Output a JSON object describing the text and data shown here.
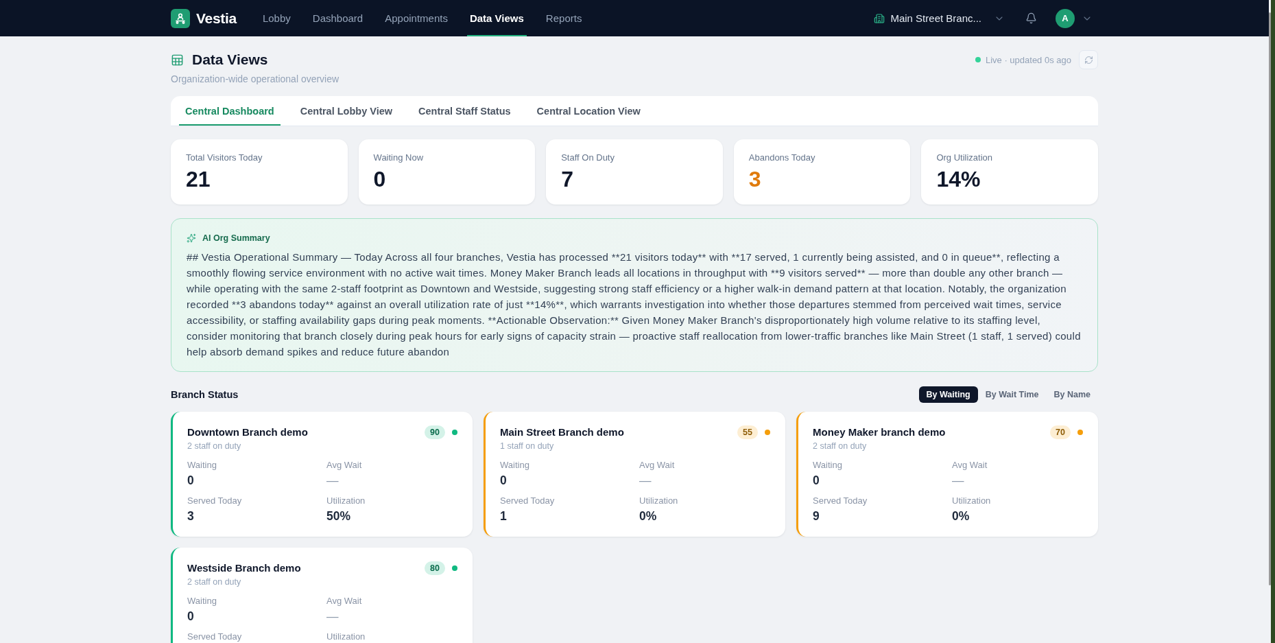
{
  "nav": {
    "brand": "Vestia",
    "items": [
      {
        "label": "Lobby",
        "selected": false
      },
      {
        "label": "Dashboard",
        "selected": false
      },
      {
        "label": "Appointments",
        "selected": false
      },
      {
        "label": "Data Views",
        "selected": true
      },
      {
        "label": "Reports",
        "selected": false
      }
    ],
    "branch_selector": "Main Street Branc...",
    "avatar": "A"
  },
  "header": {
    "title": "Data Views",
    "subtitle": "Organization-wide operational overview",
    "live_status": "Live · updated 0s ago"
  },
  "tabs": [
    {
      "label": "Central Dashboard",
      "selected": true
    },
    {
      "label": "Central Lobby View",
      "selected": false
    },
    {
      "label": "Central Staff Status",
      "selected": false
    },
    {
      "label": "Central Location View",
      "selected": false
    }
  ],
  "kpis": [
    {
      "label": "Total Visitors Today",
      "value": "21",
      "color": "#0f172a"
    },
    {
      "label": "Waiting Now",
      "value": "0",
      "color": "#0f172a"
    },
    {
      "label": "Staff On Duty",
      "value": "7",
      "color": "#0f172a"
    },
    {
      "label": "Abandons Today",
      "value": "3",
      "color": "#e07b0c"
    },
    {
      "label": "Org Utilization",
      "value": "14%",
      "color": "#0f172a"
    }
  ],
  "ai_summary": {
    "title": "AI Org Summary",
    "text": "## Vestia Operational Summary — Today Across all four branches, Vestia has processed **21 visitors today** with **17 served, 1 currently being assisted, and 0 in queue**, reflecting a smoothly flowing service environment with no active wait times. Money Maker Branch leads all locations in throughput with **9 visitors served** — more than double any other branch — while operating with the same 2-staff footprint as Downtown and Westside, suggesting strong staff efficiency or a higher walk-in demand pattern at that location. Notably, the organization recorded **3 abandons today** against an overall utilization rate of just **14%**, which warrants investigation into whether those departures stemmed from perceived wait times, service accessibility, or staffing availability gaps during peak moments. **Actionable Observation:** Given Money Maker Branch's disproportionately high volume relative to its staffing level, consider monitoring that branch closely during peak hours for early signs of capacity strain — proactive staff reallocation from lower-traffic branches like Main Street (1 staff, 1 served) could help absorb demand spikes and reduce future abandon"
  },
  "branch_status": {
    "title": "Branch Status",
    "sort_options": [
      {
        "label": "By Waiting",
        "selected": true
      },
      {
        "label": "By Wait Time",
        "selected": false
      },
      {
        "label": "By Name",
        "selected": false
      }
    ],
    "branches": [
      {
        "name": "Downtown Branch demo",
        "staff": "2 staff on duty",
        "score": "90",
        "color": "#10b981",
        "metrics": [
          {
            "label": "Waiting",
            "value": "0",
            "kind": "number"
          },
          {
            "label": "Avg Wait",
            "value": "—",
            "kind": "none"
          },
          {
            "label": "Served Today",
            "value": "3",
            "kind": "number"
          },
          {
            "label": "Utilization",
            "value": "50%",
            "kind": "number"
          }
        ]
      },
      {
        "name": "Main Street Branch demo",
        "staff": "1 staff on duty",
        "score": "55",
        "color": "#f59e0b",
        "metrics": [
          {
            "label": "Waiting",
            "value": "0",
            "kind": "number"
          },
          {
            "label": "Avg Wait",
            "value": "—",
            "kind": "none"
          },
          {
            "label": "Served Today",
            "value": "1",
            "kind": "number"
          },
          {
            "label": "Utilization",
            "value": "0%",
            "kind": "number"
          }
        ]
      },
      {
        "name": "Money Maker branch demo",
        "staff": "2 staff on duty",
        "score": "70",
        "color": "#f59e0b",
        "metrics": [
          {
            "label": "Waiting",
            "value": "0",
            "kind": "number"
          },
          {
            "label": "Avg Wait",
            "value": "—",
            "kind": "none"
          },
          {
            "label": "Served Today",
            "value": "9",
            "kind": "number"
          },
          {
            "label": "Utilization",
            "value": "0%",
            "kind": "number"
          }
        ]
      },
      {
        "name": "Westside Branch demo",
        "staff": "2 staff on duty",
        "score": "80",
        "color": "#10b981",
        "metrics": [
          {
            "label": "Waiting",
            "value": "0",
            "kind": "number"
          },
          {
            "label": "Avg Wait",
            "value": "—",
            "kind": "none"
          },
          {
            "label": "Served Today"
          },
          {
            "label": "Utilization"
          }
        ]
      }
    ]
  }
}
